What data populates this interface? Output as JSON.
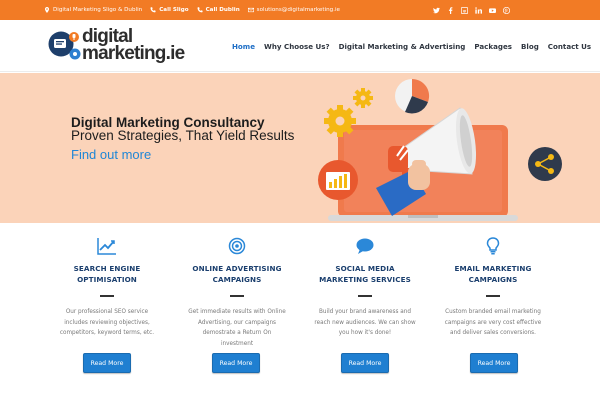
{
  "topbar": {
    "location": "Digital Marketing Sligo & Dublin",
    "phone1": "Call Sligo",
    "phone2": "Call Dublin",
    "email": "solutions@digitalmarketing.ie",
    "social_icons": [
      "twitter-icon",
      "facebook-icon",
      "google-plus-icon",
      "linkedin-icon",
      "youtube-icon",
      "pinterest-icon"
    ]
  },
  "logo": {
    "line1": "digital",
    "line2": "marketing.ie"
  },
  "nav": {
    "items": [
      "Home",
      "Why Choose Us?",
      "Digital Marketing & Advertising",
      "Packages",
      "Blog",
      "Contact Us"
    ],
    "active": "Home"
  },
  "hero": {
    "title": "Digital Marketing Consultancy",
    "subtitle": "Proven Strategies, That Yield Results",
    "link": "Find out more"
  },
  "services": [
    {
      "icon": "line-chart-icon",
      "title_line1": "SEARCH ENGINE",
      "title_line2": "OPTIMISATION",
      "description": "Our professional SEO service includes reviewing objectives, competitors, keyword terms, etc.",
      "button": "Read More"
    },
    {
      "icon": "target-icon",
      "title_line1": "ONLINE ADVERTISING",
      "title_line2": "CAMPAIGNS",
      "description": "Get immediate results with Online Advertising, our campaigns demostrate a Return On investment",
      "button": "Read More"
    },
    {
      "icon": "speech-bubble-icon",
      "title_line1": "SOCIAL MEDIA",
      "title_line2": "MARKETING SERVICES",
      "description": "Build your brand awareness and reach new audiences. We can show you how it's done!",
      "button": "Read More"
    },
    {
      "icon": "lightbulb-icon",
      "title_line1": "EMAIL MARKETING",
      "title_line2": "CAMPAIGNS",
      "description": "Custom branded email marketing campaigns are very cost effective and deliver sales conversions.",
      "button": "Read More"
    }
  ],
  "colors": {
    "topbar": "#f27b25",
    "hero_bg": "#fbd3b9",
    "accent_blue": "#1f7fd1",
    "nav_active": "#1e6ec6",
    "service_title": "#1b3f6e"
  }
}
